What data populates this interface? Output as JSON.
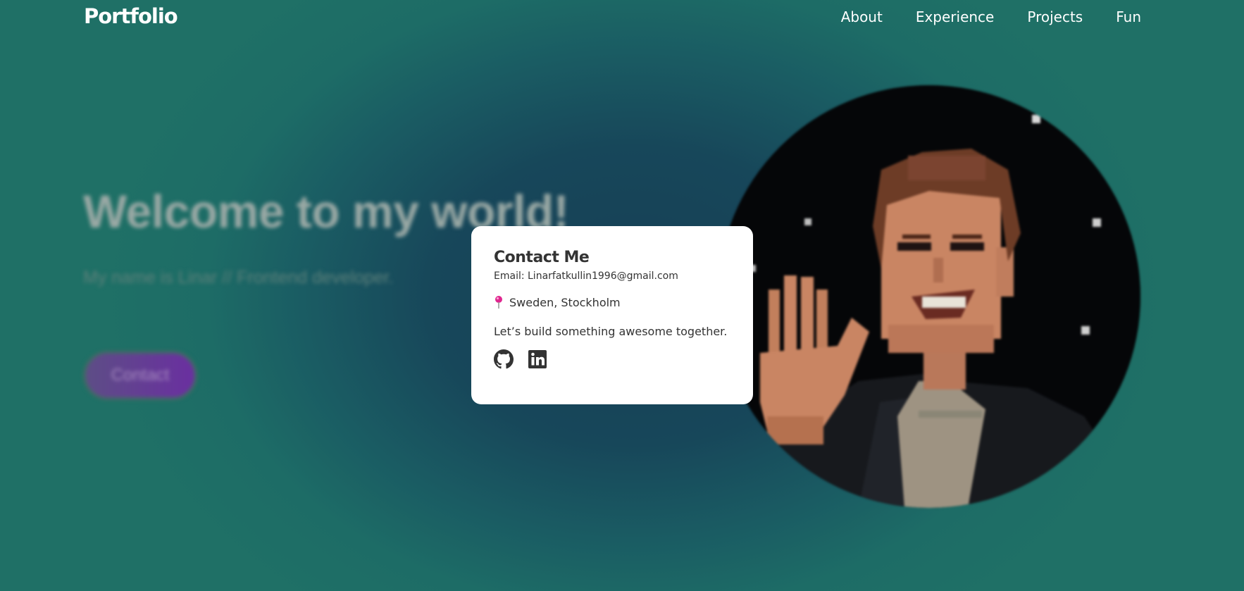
{
  "header": {
    "logo": "Portfolio",
    "nav": [
      {
        "label": "About"
      },
      {
        "label": "Experience"
      },
      {
        "label": "Projects"
      },
      {
        "label": "Fun"
      }
    ]
  },
  "hero": {
    "title": "Welcome to my world!",
    "subtitle": "My name is Linar // Frontend developer.",
    "button_label": "Contact",
    "avatar_icon": "pixel-art-avatar"
  },
  "contact_modal": {
    "title": "Contact Me",
    "email": "Email: Linarfatkullin1996@gmail.com",
    "location_icon": "pushpin-icon",
    "location": "Sweden, Stockholm",
    "tagline": "Let’s build something awesome together.",
    "social": [
      {
        "icon": "github-icon"
      },
      {
        "icon": "linkedin-icon"
      }
    ]
  },
  "colors": {
    "background": "#1d6c66",
    "background_center": "#173f55",
    "card": "#ffffff",
    "text_dark": "#333333",
    "accent_purple": "#6a2fa0",
    "pin": "#e0268f"
  }
}
